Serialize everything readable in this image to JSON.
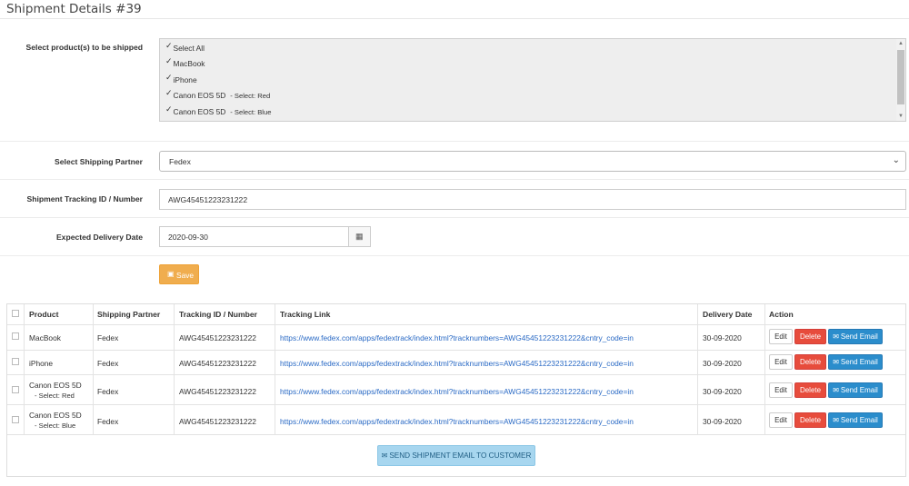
{
  "page": {
    "title": "Shipment Details #39"
  },
  "form": {
    "products_label": "Select product(s) to be shipped",
    "products": [
      {
        "label": "Select All",
        "variant": "",
        "checked": true
      },
      {
        "label": "MacBook",
        "variant": "",
        "checked": true
      },
      {
        "label": "iPhone",
        "variant": "",
        "checked": true
      },
      {
        "label": "Canon EOS 5D",
        "variant": "- Select: Red",
        "checked": true
      },
      {
        "label": "Canon EOS 5D",
        "variant": "- Select: Blue",
        "checked": true
      }
    ],
    "partner_label": "Select Shipping Partner",
    "partner_value": "Fedex",
    "tracking_label": "Shipment Tracking ID / Number",
    "tracking_value": "AWG45451223231222",
    "date_label": "Expected Delivery Date",
    "date_value": "2020-09-30",
    "save_label": "Save"
  },
  "table": {
    "headers": [
      "Product",
      "Shipping Partner",
      "Tracking ID / Number",
      "Tracking Link",
      "Delivery Date",
      "Action"
    ],
    "rows": [
      {
        "product": "MacBook",
        "variant": "",
        "partner": "Fedex",
        "tracking_id": "AWG45451223231222",
        "link": "https://www.fedex.com/apps/fedextrack/index.html?tracknumbers=AWG45451223231222&cntry_code=in",
        "date": "30-09-2020"
      },
      {
        "product": "iPhone",
        "variant": "",
        "partner": "Fedex",
        "tracking_id": "AWG45451223231222",
        "link": "https://www.fedex.com/apps/fedextrack/index.html?tracknumbers=AWG45451223231222&cntry_code=in",
        "date": "30-09-2020"
      },
      {
        "product": "Canon EOS 5D",
        "variant": "- Select: Red",
        "partner": "Fedex",
        "tracking_id": "AWG45451223231222",
        "link": "https://www.fedex.com/apps/fedextrack/index.html?tracknumbers=AWG45451223231222&cntry_code=in",
        "date": "30-09-2020"
      },
      {
        "product": "Canon EOS 5D",
        "variant": "- Select: Blue",
        "partner": "Fedex",
        "tracking_id": "AWG45451223231222",
        "link": "https://www.fedex.com/apps/fedextrack/index.html?tracknumbers=AWG45451223231222&cntry_code=in",
        "date": "30-09-2020"
      }
    ],
    "actions": {
      "edit": "Edit",
      "delete": "Delete",
      "send_email": "Send Email"
    },
    "send_all_label": "SEND SHIPMENT EMAIL TO CUSTOMER"
  },
  "colors": {
    "save": "#f0ad4e",
    "delete": "#e74c3c",
    "send_email": "#2b8dcc",
    "send_all": "#a7d6ef",
    "link": "#2a6ac5"
  },
  "icons": {
    "check": "check-icon",
    "save": "save-icon",
    "calendar": "calendar-icon",
    "envelope": "envelope-icon",
    "dropdown": "chevron-down-icon"
  }
}
